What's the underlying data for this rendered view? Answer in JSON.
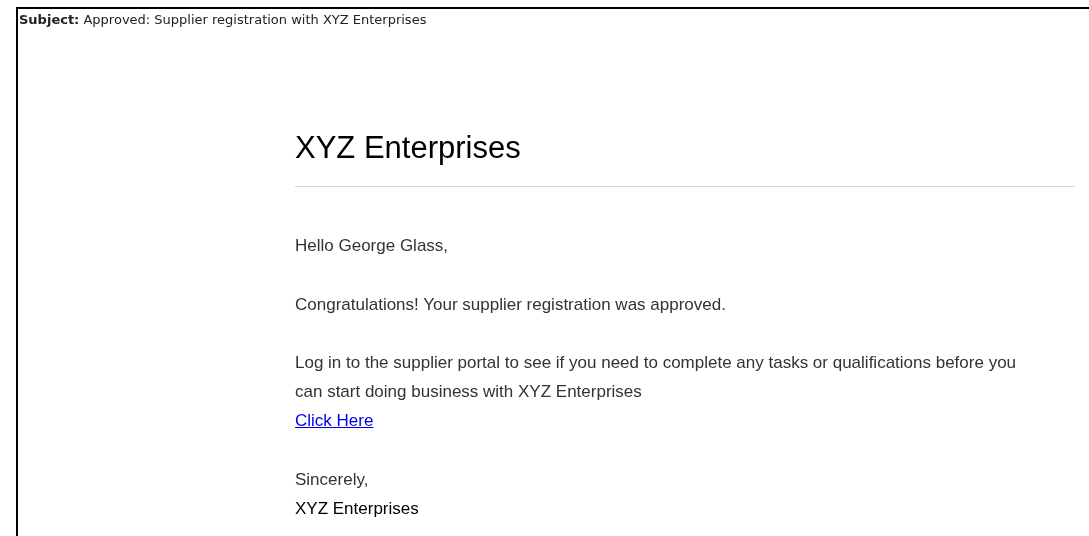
{
  "subject": {
    "label": "Subject:",
    "value": "Approved: Supplier registration with XYZ Enterprises"
  },
  "email": {
    "heading": "XYZ Enterprises",
    "greeting": "Hello George Glass,",
    "paragraphs": [
      "Congratulations! Your supplier registration was approved.",
      "Log in to the supplier portal to see if you need to complete any tasks or qualifications before you can start doing business with XYZ Enterprises"
    ],
    "link": "Click Here",
    "closing": "Sincerely,",
    "signature": "XYZ Enterprises"
  }
}
